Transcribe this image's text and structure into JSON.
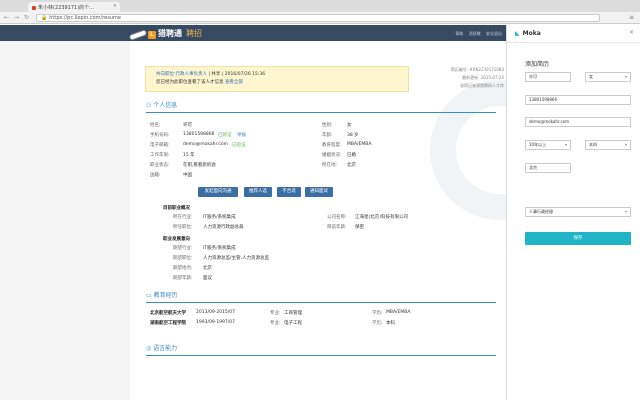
{
  "browser": {
    "tab_title": "朱小林(2239171)的个...",
    "url": "https://pc.liepin.com/resume"
  },
  "header": {
    "logo_mark": "L",
    "logo": "猎聘通",
    "logo_sub": "聘招",
    "links": [
      "帮助",
      "消息数",
      "安全退出"
    ]
  },
  "notice": {
    "line1_prefix": "共向职位:行政人事负责人",
    "line1_mid": " | 共享 | 2016/07/26 15:36",
    "line2_prefix": "您已经为此职位查看了该人才信息",
    "line2_link": "查看全部"
  },
  "meta": {
    "id": "简历编号: #RN2239171084",
    "updated": "最新更新: 2015-07-26",
    "note": "该简历来源猎聘网人才库"
  },
  "personal": {
    "title": "个人信息",
    "rows": [
      {
        "l1": "姓名:",
        "v1": "许可",
        "l2": "性别:",
        "v2": "女"
      },
      {
        "l1": "手机号码:",
        "v1": "13801598866",
        "t1": "已验证",
        "b1": "举报",
        "l2": "年龄:",
        "v2": "38 岁"
      },
      {
        "l1": "电子邮箱:",
        "v1": "demo@mokahr.com",
        "t1": "已验证",
        "l2": "教育程度:",
        "v2": "MBA/EMBA"
      },
      {
        "l1": "工作年限:",
        "v1": "15 年",
        "l2": "婚姻状况:",
        "v2": "已婚"
      },
      {
        "l1": "职业状态:",
        "v1": "在职,看看新机会",
        "l2": "所在地:",
        "v2": "北京"
      },
      {
        "l1": "国籍:",
        "v1": "中国",
        "l2": "",
        "v2": ""
      }
    ],
    "buttons": [
      "发起面向沟通",
      "推荐人选",
      "不合适",
      "通知面试"
    ]
  },
  "current": {
    "title": "目前职业概况",
    "rows": [
      {
        "l1": "所在行业:",
        "v1": "IT服务/系统集成",
        "l2": "公司名称:",
        "v2": "江海星(北京)科技有限公司"
      },
      {
        "l1": "所任职位:",
        "v1": "人力资源行政副总裁",
        "l2": "目前年薪:",
        "v2": "保密"
      }
    ]
  },
  "intent": {
    "title": "职业发展意向",
    "rows": [
      {
        "l": "期望行业:",
        "v": "IT服务/系统集成"
      },
      {
        "l": "期望职位:",
        "v": "人力资源总监/主管,人力资源总监"
      },
      {
        "l": "期望地点:",
        "v": "北京"
      },
      {
        "l": "期望年薪:",
        "v": "面议"
      }
    ]
  },
  "education": {
    "title": "教育经历",
    "rows": [
      {
        "school": "北京航空航天大学",
        "period": "2013/09-2015/07",
        "major_l": "专业:",
        "major": "工商管理",
        "deg_l": "学历:",
        "deg": "MBA/EMBA"
      },
      {
        "school": "湖南航空工程学院",
        "period": "1993/09-1997/07",
        "major_l": "专业:",
        "major": "电子工程",
        "deg_l": "学历:",
        "deg": "本科"
      }
    ]
  },
  "language": {
    "title": "语言能力"
  },
  "panel": {
    "brand": "Moka",
    "title": "添加简历",
    "name": "许可",
    "gender": "女",
    "phone": "13801598866",
    "email": "demo@mokahr.com",
    "experience": "10年以上",
    "degree": "本科",
    "city": "北京",
    "stage": "人事行政经理",
    "save": "保存"
  }
}
